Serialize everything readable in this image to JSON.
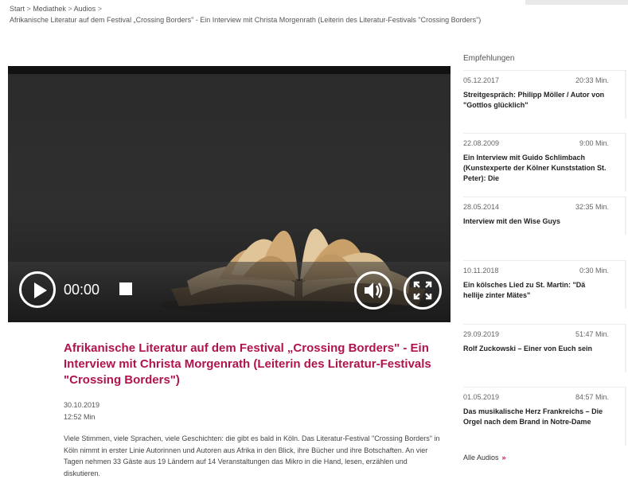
{
  "breadcrumb": {
    "items": [
      "Start",
      "Mediathek",
      "Audios"
    ],
    "separator": ">",
    "current": "Afrikanische Literatur auf dem Festival „Crossing Borders\" - Ein Interview mit Christa Morgenrath (Leiterin des Literatur-Festivals \"Crossing Borders\")"
  },
  "player": {
    "time": "00:00",
    "icons": [
      "play-icon",
      "volume-icon",
      "fullscreen-icon"
    ]
  },
  "article": {
    "title": "Afrikanische Literatur auf dem Festival „Crossing Borders\" - Ein Interview mit Christa Morgenrath (Leiterin des Literatur-Festivals \"Crossing Borders\")",
    "date": "30.10.2019",
    "duration": "12:52 Min",
    "body": "Viele Stimmen, viele Sprachen, viele Geschichten: die gibt es bald in Köln. Das Literatur-Festival \"Crossing Borders\" in Köln nimmt in erster Linie Autorinnen und Autoren aus Afrika in den Blick, ihre Bücher und ihre Botschaften. An vier Tagen nehmen 33 Gäste aus 19 Ländern auf 14 Veranstaltungen das Mikro in die Hand, lesen, erzählen und diskutieren."
  },
  "sidebar": {
    "heading": "Empfehlungen",
    "items": [
      {
        "date": "05.12.2017",
        "duration": "20:33 Min.",
        "title": "Streitgespräch: Philipp Möller / Autor von \"Gottlos glücklich\""
      },
      {
        "date": "22.08.2009",
        "duration": "9:00 Min.",
        "title": "Ein Interview mit Guido Schlimbach (Kunstexperte der Kölner Kunststation St. Peter): Die"
      },
      {
        "date": "28.05.2014",
        "duration": "32:35 Min.",
        "title": "Interview mit den Wise Guys"
      },
      {
        "date": "10.11.2018",
        "duration": "0:30 Min.",
        "title": "Ein kölsches Lied zu St. Martin: \"Dä hellije zinter Mätes\""
      },
      {
        "date": "29.09.2019",
        "duration": "51:47 Min.",
        "title": "Rolf Zuckowski – Einer von Euch sein"
      },
      {
        "date": "01.05.2019",
        "duration": "84:57 Min.",
        "title": "Das musikalische Herz Frankreichs – Die Orgel nach dem Brand in Notre-Dame"
      }
    ],
    "all_audios": "Alle Audios",
    "all_arrow": "»"
  },
  "colors": {
    "accent": "#b0134e",
    "arrow": "#c2185b"
  }
}
